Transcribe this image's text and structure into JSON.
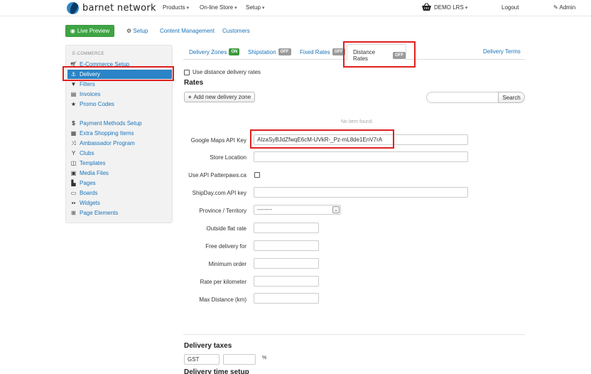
{
  "header": {
    "brand": "barnet network",
    "nav": [
      "Products",
      "On-line Store",
      "Setup"
    ],
    "store": "DEMO LRS",
    "logout": "Logout",
    "admin": "Admin"
  },
  "subbar": {
    "live_preview": "Live Preview",
    "setup": "Setup",
    "content_management": "Content Management",
    "customers": "Customers"
  },
  "sidebar": {
    "heading": "E-COMMERCE",
    "items": [
      {
        "label": "E-Commerce Setup",
        "icon": "cart-icon"
      },
      {
        "label": "Delivery",
        "icon": "delivery-icon"
      },
      {
        "label": "Filters",
        "icon": "filter-icon"
      },
      {
        "label": "Invoices",
        "icon": "invoice-icon"
      },
      {
        "label": "Promo Codes",
        "icon": "star-icon"
      },
      {
        "label": "Payment Methods Setup",
        "icon": "dollar-icon"
      },
      {
        "label": "Extra Shopping Items",
        "icon": "grid-icon"
      },
      {
        "label": "Ambassador Program",
        "icon": "shuffle-icon"
      },
      {
        "label": "Clubs",
        "icon": "glass-icon"
      },
      {
        "label": "Templates",
        "icon": "columns-icon"
      },
      {
        "label": "Media Files",
        "icon": "image-icon"
      },
      {
        "label": "Pages",
        "icon": "file-icon"
      },
      {
        "label": "Boards",
        "icon": "monitor-icon"
      },
      {
        "label": "Widgets",
        "icon": "widgets-icon"
      },
      {
        "label": "Page Elements",
        "icon": "elements-icon"
      }
    ]
  },
  "tabs": {
    "delivery_zones": "Delivery Zones",
    "delivery_zones_badge": "ON",
    "shipstation": "Shipstation",
    "shipstation_badge": "OFF",
    "fixed_rates": "Fixed Rates",
    "fixed_rates_badge": "OFF",
    "distance_rates": "Distance Rates",
    "distance_rates_badge": "OFF",
    "delivery_terms": "Delivery Terms"
  },
  "content": {
    "use_distance": "Use distance delivery rates",
    "rates_heading": "Rates",
    "add_zone": "Add new delivery zone",
    "search_btn": "Search",
    "no_item": "No item found.",
    "fields": {
      "google_key_label": "Google Maps API Key",
      "google_key_value": "AIzaSyBJdZfwqE6cM-UVkR-_Pz-mL8de1EnV7rA",
      "store_location_label": "Store Location",
      "use_api_label": "Use API Patterpaws.ca",
      "shipday_label": "ShipDay.com API key",
      "province_label": "Province / Territory",
      "province_value": "---------",
      "outside_label": "Outside flat rate",
      "free_label": "Free delivery for",
      "minimum_label": "Minimum order",
      "rate_km_label": "Rate per kilometer",
      "max_dist_label": "Max Distance (km)"
    },
    "taxes_heading": "Delivery taxes",
    "tax_name": "GST",
    "tax_unit": "%",
    "time_heading": "Delivery time setup"
  }
}
